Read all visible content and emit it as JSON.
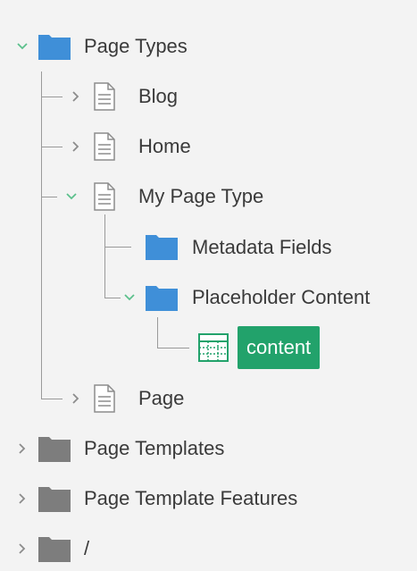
{
  "tree": {
    "root": {
      "label": "Page Types",
      "expanded": true,
      "icon": "folder-icon",
      "children": [
        {
          "label": "Blog",
          "icon": "document-icon",
          "expanded": false
        },
        {
          "label": "Home",
          "icon": "document-icon",
          "expanded": false
        },
        {
          "label": "My Page Type",
          "icon": "document-icon",
          "expanded": true,
          "children": [
            {
              "label": "Metadata Fields",
              "icon": "folder-icon"
            },
            {
              "label": "Placeholder Content",
              "icon": "folder-icon",
              "expanded": true,
              "children": [
                {
                  "label": "content",
                  "icon": "grid-icon",
                  "selected": true
                }
              ]
            }
          ]
        },
        {
          "label": "Page",
          "icon": "document-icon",
          "expanded": false
        }
      ]
    },
    "others": [
      {
        "label": "Page Templates",
        "icon": "folder-icon",
        "expanded": false
      },
      {
        "label": "Page Template Features",
        "icon": "folder-icon",
        "expanded": false
      },
      {
        "label": "/",
        "icon": "folder-icon",
        "expanded": false
      }
    ]
  },
  "colors": {
    "folder_blue": "#3f8fd8",
    "folder_gray": "#7d7d7d",
    "chevron_green": "#5cc08c",
    "chevron_gray": "#8c8c8c",
    "selected_bg": "#22a26b",
    "tree_line": "#9a9a9a"
  }
}
